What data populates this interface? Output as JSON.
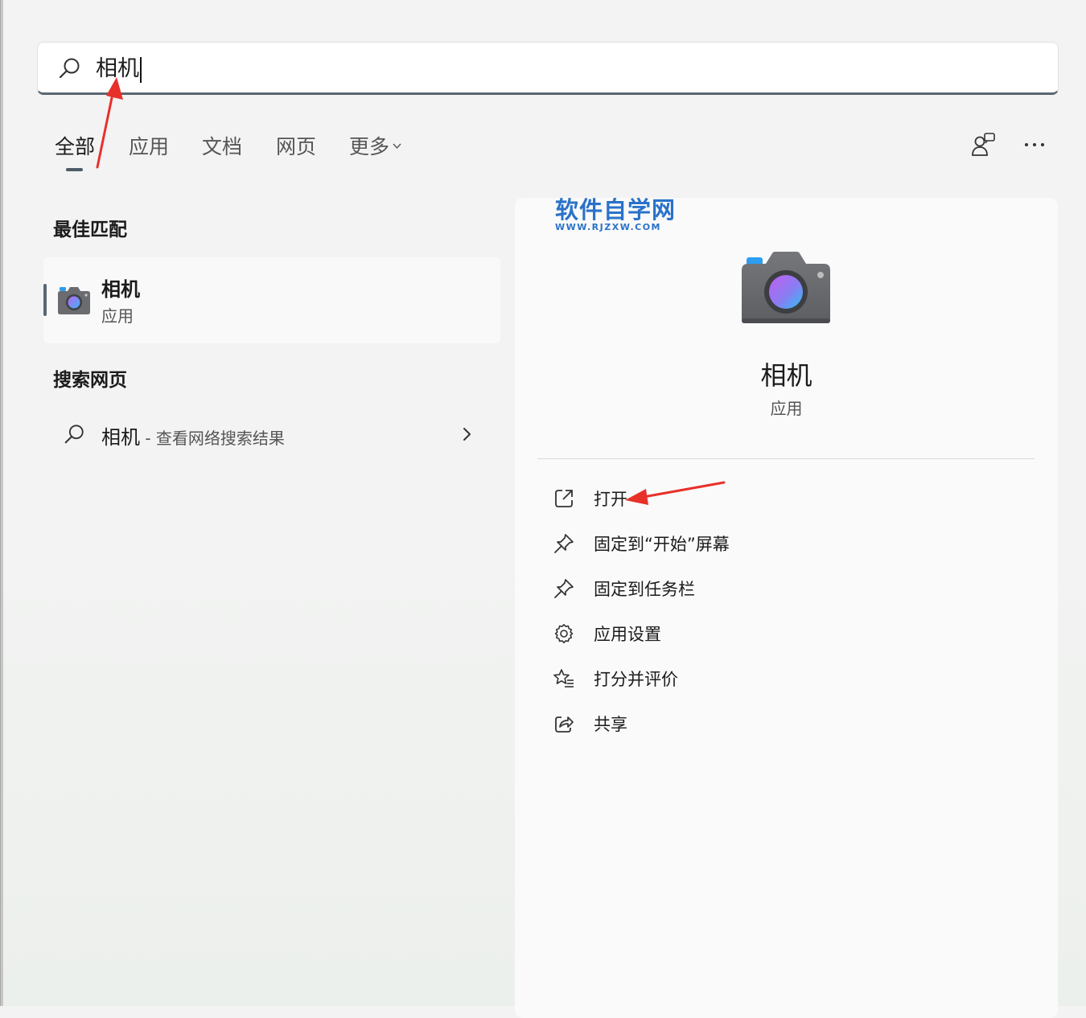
{
  "search": {
    "query": "相机"
  },
  "tabs": [
    {
      "label": "全部",
      "active": true
    },
    {
      "label": "应用"
    },
    {
      "label": "文档"
    },
    {
      "label": "网页"
    },
    {
      "label": "更多"
    }
  ],
  "best_match": {
    "heading": "最佳匹配",
    "title": "相机",
    "subtitle": "应用"
  },
  "web_search": {
    "heading": "搜索网页",
    "term": "相机",
    "suffix": " - 查看网络搜索结果"
  },
  "detail": {
    "watermark_title": "软件自学网",
    "watermark_url": "WWW.RJZXW.COM",
    "name": "相机",
    "type": "应用",
    "actions": [
      {
        "label": "打开",
        "icon": "open-external-icon"
      },
      {
        "label": "固定到“开始”屏幕",
        "icon": "pin-icon"
      },
      {
        "label": "固定到任务栏",
        "icon": "pin-icon"
      },
      {
        "label": "应用设置",
        "icon": "gear-icon"
      },
      {
        "label": "打分并评价",
        "icon": "star-list-icon"
      },
      {
        "label": "共享",
        "icon": "share-icon"
      }
    ]
  },
  "colors": {
    "accent": "#5a6772",
    "watermark": "#2a72c9",
    "annotation": "#e8302a"
  }
}
